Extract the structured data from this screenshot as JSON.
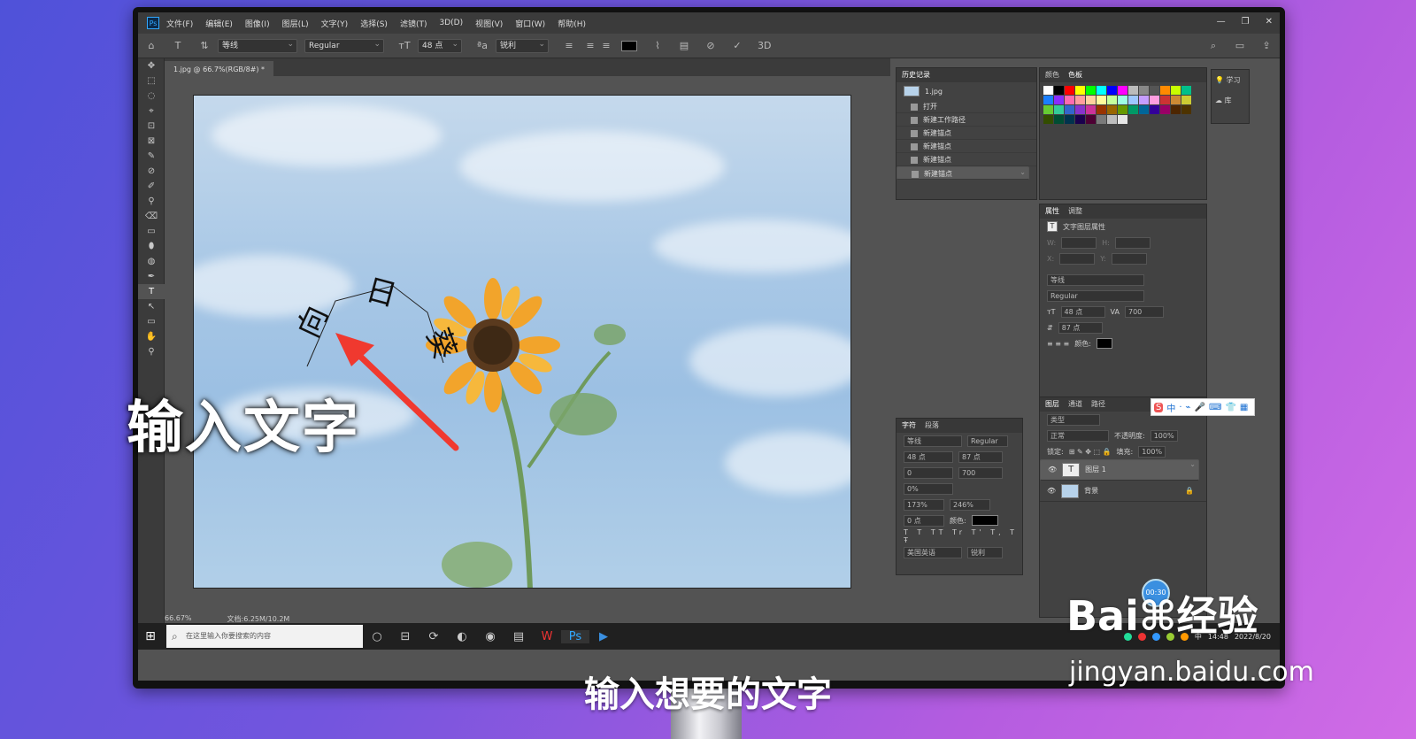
{
  "menubar": {
    "app_icon": "Ps",
    "items": [
      "文件(F)",
      "编辑(E)",
      "图像(I)",
      "图层(L)",
      "文字(Y)",
      "选择(S)",
      "滤镜(T)",
      "3D(D)",
      "视图(V)",
      "窗口(W)",
      "帮助(H)"
    ],
    "window_controls": [
      "—",
      "❐",
      "✕"
    ]
  },
  "options_bar": {
    "font_family": "等线",
    "font_style": "Regular",
    "font_size": "48 点",
    "antialias": "锐利",
    "three_d": "3D"
  },
  "document": {
    "tab_title": "1.jpg @ 66.7%(RGB/8#) *",
    "canvas_text": [
      "向",
      "日",
      "葵"
    ],
    "zoom": "66.67%",
    "doc_size": "文档:6.25M/10.2M"
  },
  "tools": [
    "✥",
    "⬚",
    "◌",
    "⌖",
    "⊡",
    "⊠",
    "✎",
    "⊘",
    "✐",
    "⚲",
    "⌫",
    "▭",
    "⬮",
    "◍",
    "✒",
    "T",
    "↖",
    "▭",
    "✋",
    "⚲"
  ],
  "history": {
    "tabs": [
      "历史记录"
    ],
    "snapshot": "1.jpg",
    "items": [
      "打开",
      "新建工作路径",
      "新建锚点",
      "新建锚点",
      "新建锚点",
      "新建锚点"
    ]
  },
  "swatches": {
    "tabs": [
      "颜色",
      "色板"
    ],
    "colors": [
      "#ffffff",
      "#000000",
      "#ff0000",
      "#ffff00",
      "#00ff00",
      "#00ffff",
      "#0000ff",
      "#ff00ff",
      "#bbbbbb",
      "#888888",
      "#555555",
      "#ff8a00",
      "#c8ff00",
      "#00c08a",
      "#1a7fff",
      "#8a2cff",
      "#ff6ab0",
      "#ff9d9d",
      "#ffd19d",
      "#fffb9d",
      "#c5ff9d",
      "#9dffe4",
      "#9dc7ff",
      "#c59dff",
      "#ff9de0",
      "#cc3333",
      "#cc8a33",
      "#cccc33",
      "#66cc33",
      "#33cc99",
      "#3366cc",
      "#8833cc",
      "#cc3399",
      "#993300",
      "#996600",
      "#669900",
      "#009966",
      "#006699",
      "#330099",
      "#990066",
      "#4d2600",
      "#4d3300",
      "#334d00",
      "#004d33",
      "#00334d",
      "#1a004d",
      "#4d0033",
      "#7a7a7a",
      "#bdbdbd",
      "#e6e6e6"
    ]
  },
  "properties": {
    "tabs": [
      "属性",
      "调整"
    ],
    "title": "文字图层属性",
    "w": "W:",
    "h": "H:",
    "x": "X:",
    "y": "Y:",
    "font_family": "等线",
    "font_style": "Regular",
    "font_size": "48 点",
    "tracking": "700",
    "leading": "87 点",
    "color_label": "颜色:"
  },
  "character": {
    "tabs": [
      "字符",
      "段落"
    ],
    "font_family": "等线",
    "font_style": "Regular",
    "size": "48 点",
    "leading": "87 点",
    "kerning": "0",
    "tracking": "700",
    "scale_pct": "0%",
    "vscale": "173%",
    "hscale": "246%",
    "baseline": "0 点",
    "color_label": "颜色:",
    "language": "美国英语",
    "antialias": "锐利"
  },
  "layers": {
    "tabs": [
      "图层",
      "通道",
      "路径"
    ],
    "search_placeholder": "类型",
    "blend_mode": "正常",
    "opacity_label": "不透明度:",
    "opacity": "100%",
    "lock_label": "锁定:",
    "fill_label": "填充:",
    "fill": "100%",
    "items": [
      {
        "name": "图层 1",
        "type": "T"
      },
      {
        "name": "背景",
        "type": "img"
      }
    ]
  },
  "right_mini": [
    "学习",
    "库"
  ],
  "timer": "00:30",
  "taskbar": {
    "search_placeholder": "在这里输入你要搜索的内容",
    "apps": [
      "○",
      "⊟",
      "⟳",
      "◐",
      "◉",
      "▤",
      "W",
      "Ps",
      "▶"
    ],
    "time": "14:48",
    "date": "2022/8/20",
    "lang": "中"
  },
  "ime": [
    "S",
    "中",
    "·",
    "⌁",
    "🎤",
    "⌨",
    "👕",
    "▦"
  ],
  "overlay": {
    "callout": "输入文字",
    "subtitle": "输入想要的文字",
    "watermark": "Bai⌘经验",
    "watermark_url": "jingyan.baidu.com"
  }
}
